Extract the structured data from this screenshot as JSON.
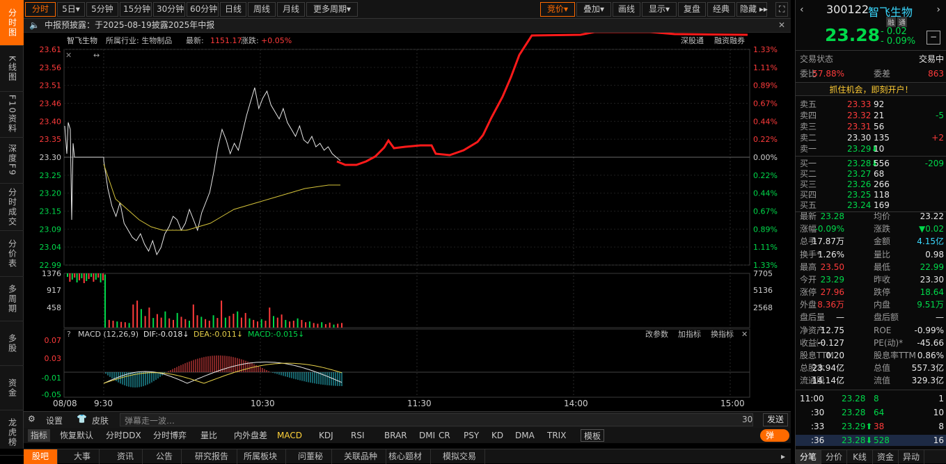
{
  "left_nav": [
    {
      "label": "分时图",
      "active": true
    },
    {
      "label": "K线图",
      "active": false
    },
    {
      "label": "F10资料",
      "active": false
    },
    {
      "label": "深度F9",
      "active": false
    },
    {
      "label": "分时成交",
      "active": false
    },
    {
      "label": "分价表",
      "active": false
    },
    {
      "label": "多周期",
      "active": false
    },
    {
      "label": "多股",
      "active": false
    },
    {
      "label": "资金",
      "active": false
    },
    {
      "label": "龙虎榜",
      "active": false
    }
  ],
  "toolbar": {
    "periods": [
      "分时",
      "5日▾",
      "5分钟",
      "15分钟",
      "30分钟",
      "60分钟",
      "日线",
      "周线",
      "月线",
      "更多周期▾"
    ],
    "tools": [
      "竞价▾",
      "叠加▾",
      "画线",
      "显示▾",
      "复盘",
      "经典",
      "隐藏 ▸▸"
    ]
  },
  "info_bar": {
    "text": "中报预披露：于2025-08-19披露2025年中报"
  },
  "chart_header": {
    "stock": "智飞生物",
    "industry": "所属行业: 生物制品",
    "latest_label": "最新:",
    "latest_value": "1151.17",
    "change_label": "涨跌:",
    "change_value": "+0.05%",
    "right_links": [
      "深股通",
      "融资融券"
    ]
  },
  "price_axis": [
    "23.61",
    "23.56",
    "23.51",
    "23.46",
    "23.40",
    "23.35",
    "23.30",
    "23.25",
    "23.20",
    "23.15",
    "23.09",
    "23.04",
    "22.99"
  ],
  "pct_axis": [
    "1.33%",
    "1.11%",
    "0.89%",
    "0.67%",
    "0.44%",
    "0.22%",
    "0.00%",
    "0.22%",
    "0.44%",
    "0.67%",
    "0.89%",
    "1.11%",
    "1.33%"
  ],
  "volume_axis_left": [
    "1376",
    "917",
    "458"
  ],
  "volume_axis_right": [
    "7705",
    "5136",
    "2568"
  ],
  "macd": {
    "label": "MACD (12,26,9)",
    "dif": "DIF:-0.018↓",
    "dea": "DEA:-0.011↓",
    "macd": "MACD:-0.015↓",
    "links": [
      "改参数",
      "加指标",
      "换指标"
    ],
    "axis": [
      "0.07",
      "0.03",
      "-0.01",
      "-0.05"
    ]
  },
  "time_axis": [
    "08/08",
    "9:30",
    "10:30",
    "11:30",
    "14:00",
    "15:00"
  ],
  "bottom_bar": {
    "settings": "设置",
    "skin": "皮肤",
    "danmu_placeholder": "弹幕走一波…",
    "count": "30",
    "send": "发送"
  },
  "indicator_tabs": [
    "指标",
    "恢复默认",
    "分时DDX",
    "分时博弈",
    "量比",
    "内外盘差",
    "MACD",
    "KDJ",
    "RSI",
    "BRAR",
    "DMI",
    "CR",
    "PSY",
    "KD",
    "DMA",
    "TRIX",
    "模板"
  ],
  "danmu_toggle": "弹",
  "page_tabs": [
    "股吧",
    "大事",
    "资讯",
    "公告",
    "研究报告",
    "所属板块",
    "问董秘",
    "关联品种",
    "核心题材",
    "模拟交易"
  ],
  "quote": {
    "code": "300122",
    "name": "智飞生物",
    "badges": [
      "融",
      "通"
    ],
    "price": "23.28",
    "change": "- 0.02",
    "change_pct": "- 0.09%",
    "trade_status_label": "交易状态",
    "trade_status": "交易中",
    "weibi_label": "委比",
    "weibi": "57.88%",
    "weicha_label": "委差",
    "weicha": "863",
    "promo": "抓住机会，即刻开户！",
    "asks": [
      {
        "label": "卖五",
        "price": "23.33",
        "vol": "92",
        "chg": ""
      },
      {
        "label": "卖四",
        "price": "23.32",
        "vol": "21",
        "chg": "-5"
      },
      {
        "label": "卖三",
        "price": "23.31",
        "vol": "56",
        "chg": ""
      },
      {
        "label": "卖二",
        "price": "23.30",
        "vol": "135",
        "chg": "+2"
      },
      {
        "label": "卖一",
        "price": "23.29⬇",
        "vol": "10",
        "chg": ""
      }
    ],
    "bids": [
      {
        "label": "买一",
        "price": "23.28⬇",
        "vol": "556",
        "chg": "-209"
      },
      {
        "label": "买二",
        "price": "23.27",
        "vol": "68",
        "chg": ""
      },
      {
        "label": "买三",
        "price": "23.26",
        "vol": "266",
        "chg": ""
      },
      {
        "label": "买四",
        "price": "23.25",
        "vol": "118",
        "chg": ""
      },
      {
        "label": "买五",
        "price": "23.24",
        "vol": "169",
        "chg": ""
      }
    ],
    "stats": [
      {
        "l1": "最新",
        "v1": "23.28",
        "c1": "green",
        "l2": "均价",
        "v2": "23.22",
        "c2": "white"
      },
      {
        "l1": "涨幅",
        "v1": "-0.09%",
        "c1": "green",
        "l2": "涨跌",
        "v2": "▼0.02",
        "c2": "green"
      },
      {
        "l1": "总手",
        "v1": "17.87万",
        "c1": "white",
        "l2": "金额",
        "v2": "4.15亿",
        "c2": "cyan"
      },
      {
        "l1": "换手*",
        "v1": "1.26%",
        "c1": "white",
        "l2": "量比",
        "v2": "0.98",
        "c2": "white"
      },
      {
        "l1": "最高",
        "v1": "23.50",
        "c1": "red",
        "l2": "最低",
        "v2": "22.99",
        "c2": "green"
      },
      {
        "l1": "今开",
        "v1": "23.29",
        "c1": "green",
        "l2": "昨收",
        "v2": "23.30",
        "c2": "white"
      },
      {
        "l1": "涨停",
        "v1": "27.96",
        "c1": "red",
        "l2": "跌停",
        "v2": "18.64",
        "c2": "green"
      },
      {
        "l1": "外盘",
        "v1": "8.36万",
        "c1": "red",
        "l2": "内盘",
        "v2": "9.51万",
        "c2": "green"
      },
      {
        "l1": "盘后量",
        "v1": "—",
        "c1": "white",
        "l2": "盘后额",
        "v2": "—",
        "c2": "white"
      },
      {
        "l1": "净资产",
        "v1": "12.75",
        "c1": "white",
        "l2": "ROE",
        "v2": "-0.99%",
        "c2": "white"
      },
      {
        "l1": "收益㈠",
        "v1": "-0.127",
        "c1": "white",
        "l2": "PE(动)*",
        "v2": "-45.66",
        "c2": "white"
      },
      {
        "l1": "股息TTM",
        "v1": "0.20",
        "c1": "white",
        "l2": "股息率TTM",
        "v2": "0.86%",
        "c2": "white"
      },
      {
        "l1": "总股本",
        "v1": "23.94亿",
        "c1": "white",
        "l2": "总值",
        "v2": "557.3亿",
        "c2": "white"
      },
      {
        "l1": "流通股",
        "v1": "14.14亿",
        "c1": "white",
        "l2": "流值",
        "v2": "329.3亿",
        "c2": "white"
      }
    ],
    "ticks": [
      {
        "time": "11:00",
        "price": "23.28",
        "vol": "8",
        "n": "1",
        "pc": "green",
        "vc": "green"
      },
      {
        "time": ":30",
        "price": "23.28",
        "vol": "64",
        "n": "10",
        "pc": "green",
        "vc": "green"
      },
      {
        "time": ":33",
        "price": "23.29⬆",
        "vol": "38",
        "n": "8",
        "pc": "green",
        "vc": "red"
      },
      {
        "time": ":36",
        "price": "23.28⬇",
        "vol": "528",
        "n": "16",
        "pc": "green",
        "vc": "green"
      }
    ],
    "tabs": [
      "分笔",
      "分价",
      "K线",
      "资金",
      "异动"
    ]
  },
  "colors": {
    "accent": "#ff6a00",
    "up": "#ff3b3b",
    "down": "#00d94a",
    "price_line": "#e8e8e8",
    "avg_line": "#d6c43a",
    "drawn_line": "#ff1a1a"
  }
}
